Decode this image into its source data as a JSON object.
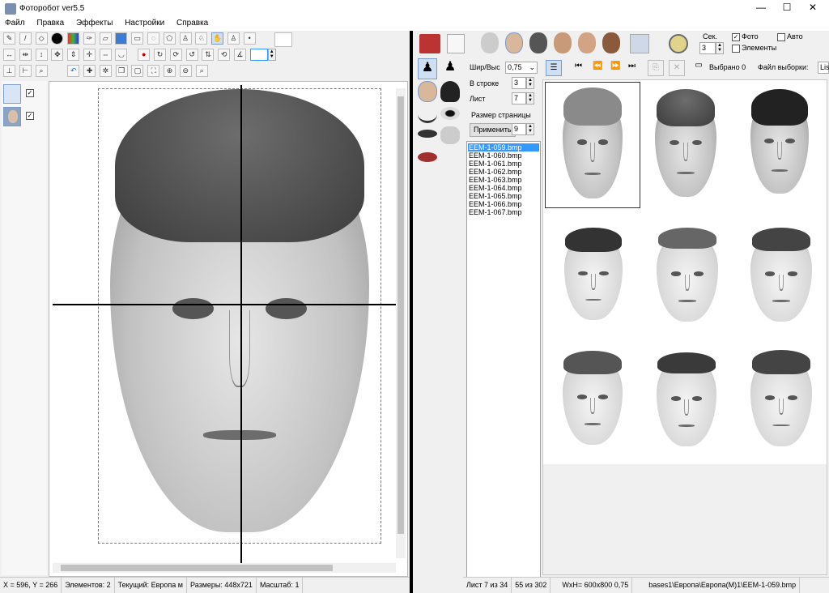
{
  "window": {
    "title": "Фоторобот  ver5.5",
    "controls": {
      "minimize": "—",
      "maximize": "☐",
      "close": "✕"
    }
  },
  "menu": [
    "Файл",
    "Правка",
    "Эффекты",
    "Настройки",
    "Справка"
  ],
  "left_status": {
    "coords": "X = 596, Y = 266",
    "elements": "Элементов: 2",
    "current": "Текущий: Европа м",
    "size": "Размеры: 448x721",
    "scale": "Масштаб: 1"
  },
  "right_panel": {
    "timer_label": "Сек.",
    "timer_value": "3",
    "photo_label": "Фото",
    "auto_label": "Авто",
    "elements_label": "Элементы",
    "selected_label": "Выбрано 0",
    "sample_file_label": "Файл выборки:",
    "sample_file_value": "Lis",
    "ratio_label": "Шир/Выс",
    "ratio_value": "0,75",
    "row_label": "В строке",
    "row_value": "3",
    "sheet_label": "Лист",
    "sheet_value": "7",
    "page_size_label": "Размер страницы",
    "apply_button": "Применить",
    "apply_value": "9",
    "files": [
      "EEM-1-059.bmp",
      "EEM-1-060.bmp",
      "EEM-1-061.bmp",
      "EEM-1-062.bmp",
      "EEM-1-063.bmp",
      "EEM-1-064.bmp",
      "EEM-1-065.bmp",
      "EEM-1-066.bmp",
      "EEM-1-067.bmp"
    ],
    "selected_file_index": 0
  },
  "right_status": {
    "sheet": "Лист 7  из 34",
    "count": "55 из 302",
    "wh": "WxH=  600x800  0,75",
    "path": "bases1\\Европа\\Европа(М)1\\EEM-1-059.bmp"
  },
  "colors": {
    "selection": "#3399ff",
    "accent": "#7a9ccc"
  }
}
